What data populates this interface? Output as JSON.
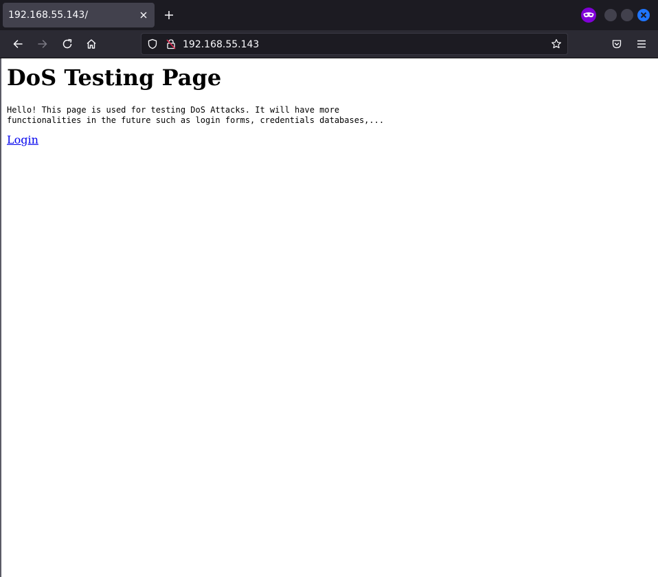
{
  "browser": {
    "tab": {
      "title": "192.168.55.143/",
      "close_icon": "close-icon"
    },
    "new_tab_icon": "plus-icon",
    "private_browsing_icon": "private-mask-icon",
    "nav": {
      "back_icon": "arrow-left-icon",
      "forward_icon": "arrow-right-icon",
      "reload_icon": "reload-icon",
      "home_icon": "home-icon"
    },
    "urlbar": {
      "url": "192.168.55.143"
    },
    "colors": {
      "chrome": "#1c1b22",
      "toolbar": "#2b2a33",
      "tab": "#42414d",
      "accent": "#1f75fe",
      "private": "#8000d7"
    }
  },
  "page": {
    "heading": "DoS Testing Page",
    "intro": "Hello! This page is used for testing DoS Attacks. It will have more\nfunctionalities in the future such as login forms, credentials databases,...",
    "login_link": "Login",
    "link_color": "#0000ee"
  }
}
